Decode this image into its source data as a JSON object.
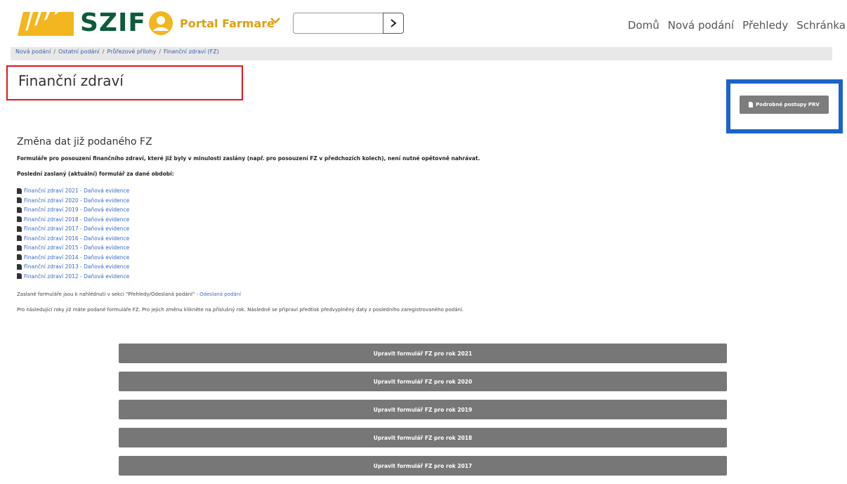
{
  "header": {
    "logo_text": "SZIF",
    "portal_label": "Portal Farmare",
    "search": {
      "value": "",
      "placeholder": ""
    },
    "nav": [
      "Domů",
      "Nová podání",
      "Přehledy",
      "Schránka"
    ]
  },
  "breadcrumb": [
    "Nová podání",
    "Ostatní podání",
    "Průřezové přílohy",
    "Finanční zdraví (FZ)"
  ],
  "page": {
    "title": "Finanční zdraví",
    "prv_button": "Podrobné postupy PRV",
    "section_heading": "Změna dat již podaného FZ",
    "bold_line_1": "Formuláře pro posouzení finančního zdraví, které již byly v minulosti zaslány (např. pro posouzení FZ v předchozích kolech), není nutné opětovně nahrávat.",
    "bold_line_2": "Poslední zaslaný (aktuální) formulář za dané období:",
    "forms": [
      "Finanční zdraví 2021 - Daňová evidence",
      "Finanční zdraví 2020 - Daňová evidence",
      "Finanční zdraví 2019 - Daňová evidence",
      "Finanční zdraví 2018 - Daňová evidence",
      "Finanční zdraví 2017 - Daňová evidence",
      "Finanční zdraví 2016 - Daňová evidence",
      "Finanční zdraví 2015 - Daňová evidence",
      "Finanční zdraví 2014 - Daňová evidence",
      "Finanční zdraví 2013 - Daňová evidence",
      "Finanční zdraví 2012 - Daňová evidence"
    ],
    "note_sent_text": "Zaslané formuláře jsou k nahlédnutí v sekci \"Přehledy/Odeslaná podání\" - ",
    "note_sent_link": "Odeslaná podání",
    "note_following": "Pro následující roky již máte podané formuláře FZ. Pro jejich změnu klikněte na příslušný rok. Následně se připraví předtisk předvyplněný daty z posledního zaregistrovaného podání.",
    "year_buttons": [
      "Upravit formulář FZ pro rok 2021",
      "Upravit formulář FZ pro rok 2020",
      "Upravit formulář FZ pro rok 2019",
      "Upravit formulář FZ pro rok 2018",
      "Upravit formulář FZ pro rok 2017"
    ]
  },
  "colors": {
    "brand_green": "#0c5c3c",
    "brand_yellow": "#f3b61f",
    "link_blue": "#3a6bc6",
    "title_highlight": "#e0151b",
    "button_highlight": "#1a64c8",
    "button_gray": "#777777"
  },
  "icons": [
    "szif-logo-stripes",
    "user-circle-icon",
    "chevron-down-icon",
    "chevron-right-icon",
    "document-icon"
  ]
}
